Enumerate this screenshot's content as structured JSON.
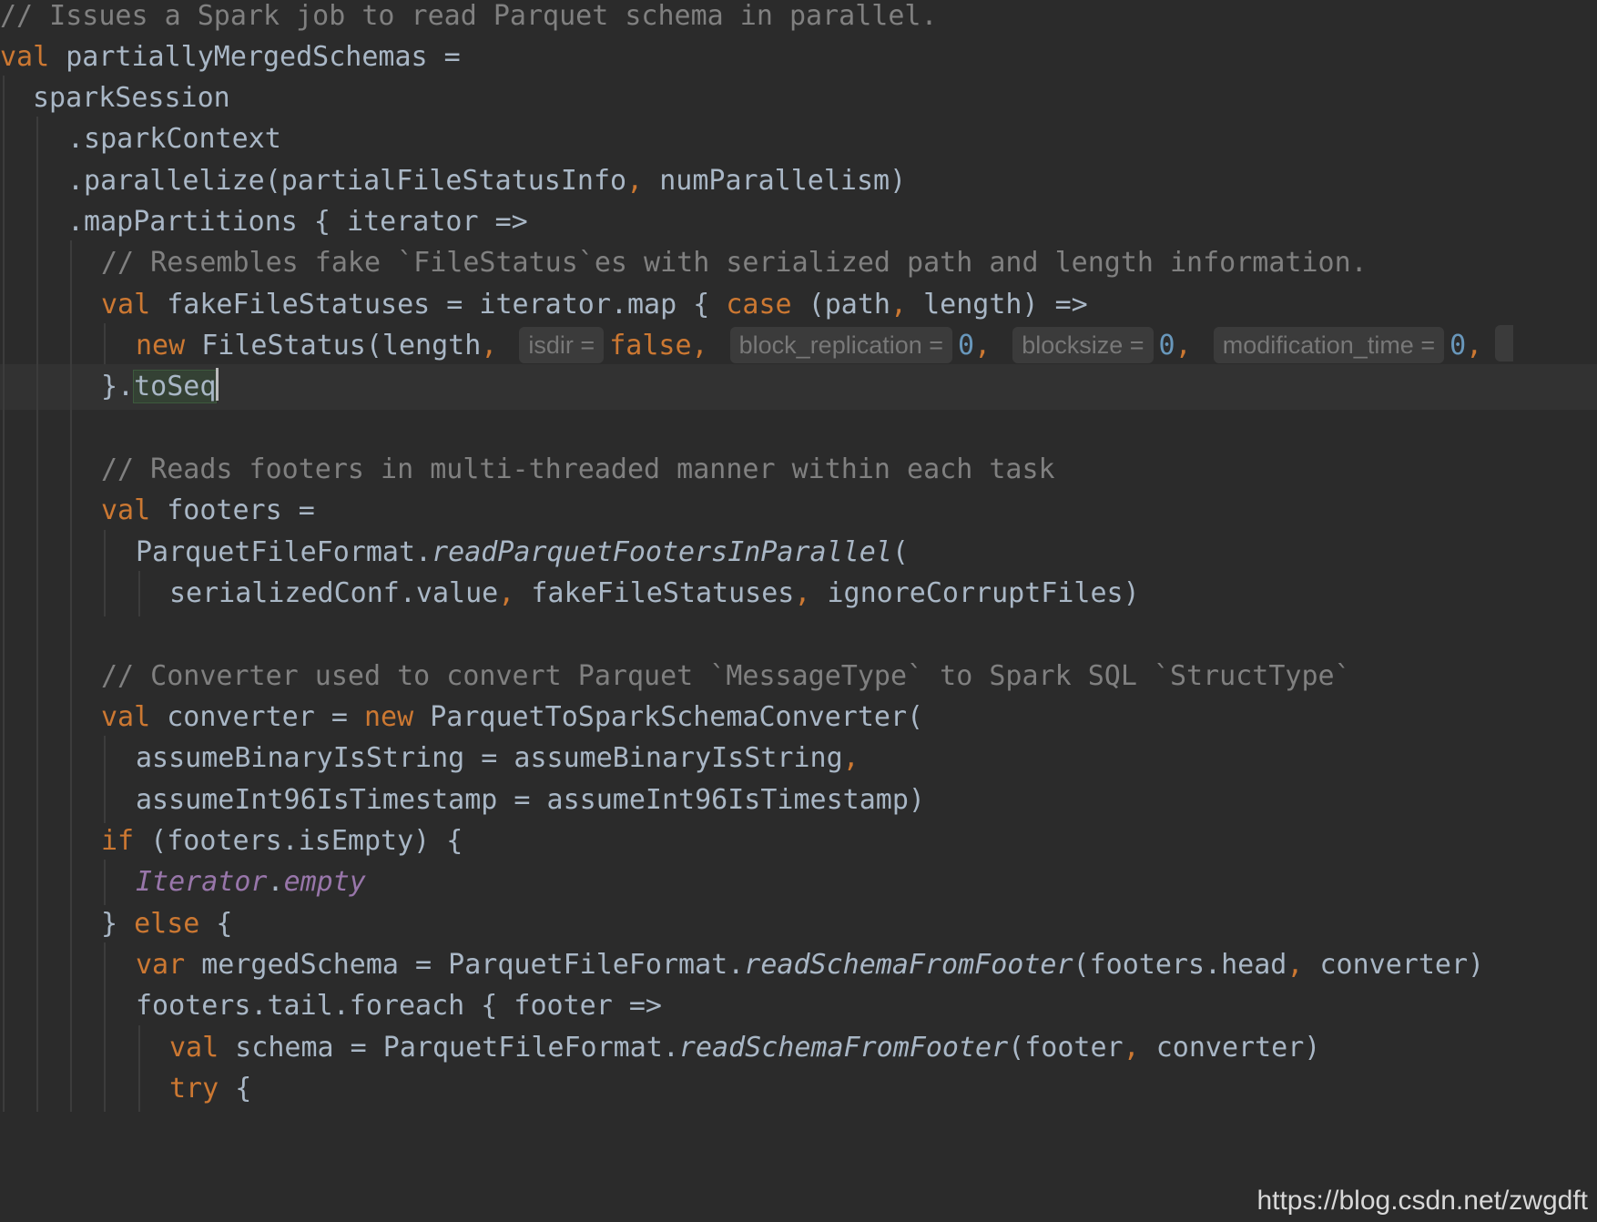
{
  "editor": {
    "language": "scala",
    "theme_colors": {
      "background": "#2b2b2b",
      "keyword": "#cc7832",
      "comment": "#808080",
      "number": "#6897bb",
      "identifier": "#a9b7c6",
      "static_member": "#9876aa"
    },
    "lines": [
      {
        "text": "// Issues a Spark job to read Parquet schema in parallel."
      },
      {
        "text": "val partiallyMergedSchemas ="
      },
      {
        "text": "sparkSession"
      },
      {
        "text": ".sparkContext"
      },
      {
        "text": ".parallelize(partialFileStatusInfo, numParallelism)"
      },
      {
        "text": ".mapPartitions { iterator =>"
      },
      {
        "text": "// Resembles fake `FileStatus`es with serialized path and length information."
      },
      {
        "text": "val fakeFileStatuses = iterator.map { case (path, length) =>"
      },
      {
        "text": "new FileStatus(length, isdir = false, block_replication = 0, blocksize = 0, modification_time = 0,"
      },
      {
        "text": "}.toSeq"
      },
      {
        "text": ""
      },
      {
        "text": "// Reads footers in multi-threaded manner within each task"
      },
      {
        "text": "val footers ="
      },
      {
        "text": "ParquetFileFormat.readParquetFootersInParallel("
      },
      {
        "text": "serializedConf.value, fakeFileStatuses, ignoreCorruptFiles)"
      },
      {
        "text": ""
      },
      {
        "text": "// Converter used to convert Parquet `MessageType` to Spark SQL `StructType`"
      },
      {
        "text": "val converter = new ParquetToSparkSchemaConverter("
      },
      {
        "text": "assumeBinaryIsString = assumeBinaryIsString,"
      },
      {
        "text": "assumeInt96IsTimestamp = assumeInt96IsTimestamp)"
      },
      {
        "text": "if (footers.isEmpty) {"
      },
      {
        "text": "Iterator.empty"
      },
      {
        "text": "} else {"
      },
      {
        "text": "var mergedSchema = ParquetFileFormat.readSchemaFromFooter(footers.head, converter)"
      },
      {
        "text": "footers.tail.foreach { footer =>"
      },
      {
        "text": "val schema = ParquetFileFormat.readSchemaFromFooter(footer, converter)"
      },
      {
        "text": "try {"
      }
    ],
    "inlay_hints": {
      "isdir": "isdir =",
      "block_replication": "block_replication =",
      "blocksize": "blocksize =",
      "modification_time": "modification_time ="
    },
    "tokens": {
      "l0": "// Issues a Spark job to read Parquet schema in parallel.",
      "l1_kw": "val",
      "l1_rest": " partiallyMergedSchemas =",
      "l2": "sparkSession",
      "l3": ".sparkContext",
      "l4_a": ".parallelize(partialFileStatusInfo",
      "l4_b": ",",
      "l4_c": " numParallelism)",
      "l5": ".mapPartitions { iterator =>",
      "l6": "// Resembles fake `FileStatus`es with serialized path and length information.",
      "l7_kw": "val",
      "l7_a": " fakeFileStatuses = iterator.map { ",
      "l7_case": "case",
      "l7_b": " (path",
      "l7_c": ",",
      "l7_d": " length) =>",
      "l8_new": "new",
      "l8_a": " FileStatus(length",
      "l8_comma": ",",
      "l8_false": "false",
      "l8_zero": "0",
      "l9_a": "}.",
      "l9_b": "toSeq",
      "l11": "// Reads footers in multi-threaded manner within each task",
      "l12_kw": "val",
      "l12_rest": " footers =",
      "l13_a": "ParquetFileFormat.",
      "l13_b": "readParquetFootersInParallel",
      "l13_c": "(",
      "l14_a": "serializedConf.value",
      "l14_b": " fakeFileStatuses",
      "l14_c": " ignoreCorruptFiles)",
      "l16": "// Converter used to convert Parquet `MessageType` to Spark SQL `StructType`",
      "l17_kw": "val",
      "l17_a": " converter = ",
      "l17_new": "new",
      "l17_b": " ParquetToSparkSchemaConverter(",
      "l18_a": "assumeBinaryIsString = assumeBinaryIsString",
      "l19": "assumeInt96IsTimestamp = assumeInt96IsTimestamp)",
      "l20_kw": "if",
      "l20_rest": " (footers.isEmpty) {",
      "l21_a": "Iterator",
      "l21_b": ".",
      "l21_c": "empty",
      "l22_a": "} ",
      "l22_kw": "else",
      "l22_b": " {",
      "l23_kw": "var",
      "l23_a": " mergedSchema = ParquetFileFormat.",
      "l23_fn": "readSchemaFromFooter",
      "l23_b": "(footers.head",
      "l23_c": " converter)",
      "l24": "footers.tail.foreach { footer =>",
      "l25_kw": "val",
      "l25_a": " schema = ParquetFileFormat.",
      "l25_fn": "readSchemaFromFooter",
      "l25_b": "(footer",
      "l25_c": " converter)",
      "l26_kw": "try",
      "l26_rest": " {"
    },
    "watermark": "https://blog.csdn.net/zwgdft"
  }
}
